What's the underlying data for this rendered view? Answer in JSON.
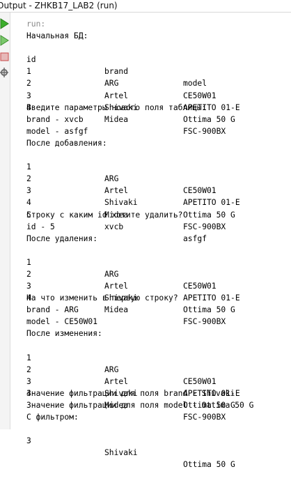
{
  "window": {
    "title": "Output - ZHKB17_LAB2 (run)"
  },
  "toolbar": {
    "buttons": [
      {
        "icon": "run-icon",
        "color": "#3cae2c"
      },
      {
        "icon": "run-again-icon",
        "color": "#3cae2c"
      },
      {
        "icon": "stop-icon",
        "color": "#c94a4a"
      },
      {
        "icon": "settings-icon",
        "color": "#6b6b6b"
      }
    ]
  },
  "console": {
    "run_label": "run:",
    "initial_db": {
      "heading": "Начальная БД:",
      "columns": [
        "id",
        "brand",
        "model"
      ],
      "rows": [
        [
          "1",
          "ARG",
          "CE50W01"
        ],
        [
          "2",
          "Artel",
          "APETITO 01-E"
        ],
        [
          "3",
          "Shivaki",
          "Ottima 50 G"
        ],
        [
          "4",
          "Midea",
          "FSC-900BX"
        ]
      ]
    },
    "input_prompt": "Введите параметры нового поля таблицы:",
    "input_brand": "brand - xvcb",
    "input_model": "model - asfgf",
    "after_add": {
      "heading": "После добавления:",
      "rows": [
        [
          "1",
          "ARG",
          "CE50W01"
        ],
        [
          "2",
          "Artel",
          "APETITO 01-E"
        ],
        [
          "3",
          "Shivaki",
          "Ottima 50 G"
        ],
        [
          "4",
          "Midea",
          "FSC-900BX"
        ],
        [
          "5",
          "xvcb",
          "asfgf"
        ]
      ]
    },
    "delete_prompt": "Строку с каким id хотите удалить?",
    "delete_id": "id - 5",
    "after_delete": {
      "heading": "После удаления:",
      "rows": [
        [
          "1",
          "ARG",
          "CE50W01"
        ],
        [
          "2",
          "Artel",
          "APETITO 01-E"
        ],
        [
          "3",
          "Shivaki",
          "Ottima 50 G"
        ],
        [
          "4",
          "Midea",
          "FSC-900BX"
        ]
      ]
    },
    "change_prompt": "На что изменить в первую строку?",
    "change_brand": "brand - ARG",
    "change_model": "model - CE50W01",
    "after_change": {
      "heading": "После изменения:",
      "rows": [
        [
          "1",
          "ARG",
          "CE50W01"
        ],
        [
          "2",
          "Artel",
          "APETITO 01-E"
        ],
        [
          "3",
          "Shivaki",
          "Ottima 50 G"
        ],
        [
          "4",
          "Midea",
          "FSC-900BX"
        ]
      ]
    },
    "filter_brand": "Значение фильтрации для поля brand - Shivaki",
    "filter_model": "Значение фильтрации для поля model - Ottima 50 G",
    "filtered": {
      "heading": "С фильтром:",
      "rows": [
        [
          "3",
          "Shivaki",
          "Ottima 50 G"
        ]
      ]
    }
  }
}
